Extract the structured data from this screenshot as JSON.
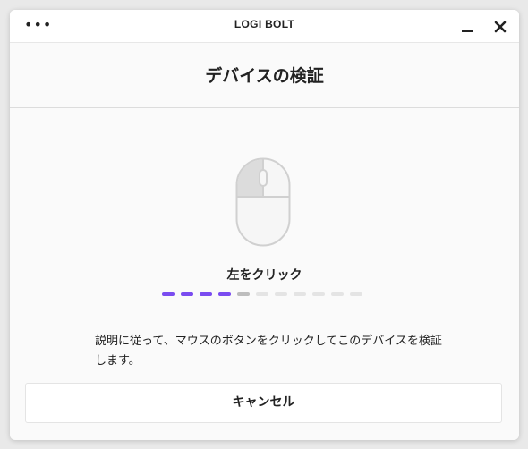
{
  "window": {
    "menu_icon": "ellipsis-icon",
    "app_title": "LOGI BOLT",
    "minimize_icon": "minimize-icon",
    "close_icon": "close-icon"
  },
  "header": {
    "title": "デバイスの検証"
  },
  "illustration": {
    "icon": "mouse-icon",
    "highlighted_button": "left"
  },
  "step": {
    "label": "左をクリック",
    "completed": 4,
    "current": 1,
    "total": 11,
    "colors": {
      "completed": "#7a4cf0",
      "current": "#bdbdbd",
      "remaining": "#e4e4e4"
    }
  },
  "instruction": {
    "text": "説明に従って、マウスのボタンをクリックしてこのデバイスを検証します。"
  },
  "actions": {
    "cancel_label": "キャンセル"
  }
}
